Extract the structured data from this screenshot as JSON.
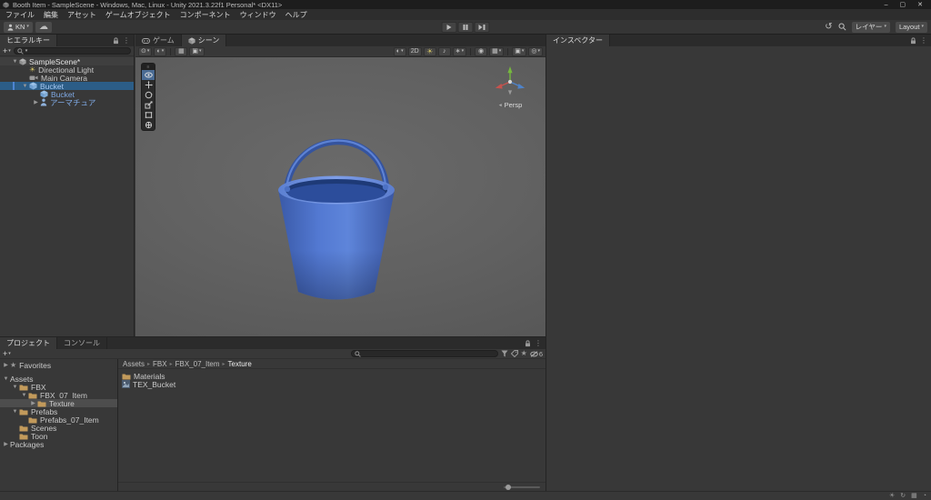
{
  "window": {
    "title": "Booth Item - SampleScene - Windows, Mac, Linux - Unity 2021.3.22f1 Personal* <DX11>",
    "minimize": "–",
    "maximize": "▢",
    "close": "✕"
  },
  "menu_bar": {
    "items": [
      "ファイル",
      "編集",
      "アセット",
      "ゲームオブジェクト",
      "コンポーネント",
      "ウィンドウ",
      "ヘルプ"
    ]
  },
  "toolbar": {
    "account_label": "KN",
    "layers_label": "レイヤー",
    "layout_label": "Layout",
    "icons": [
      "account-icon",
      "cloud-icon",
      "play-icon",
      "pause-icon",
      "step-icon",
      "undo-history-icon",
      "search-icon"
    ]
  },
  "hierarchy": {
    "tab_label": "ヒエラルキー",
    "scene_row": {
      "label": "SampleScene*",
      "expanded": true
    },
    "rows": [
      {
        "label": "Directional Light",
        "icon": "light-icon",
        "prefab": false,
        "selected": false
      },
      {
        "label": "Main Camera",
        "icon": "camera-icon",
        "prefab": false,
        "selected": false
      },
      {
        "label": "Bucket",
        "icon": "prefab-cube-icon",
        "prefab": true,
        "selected": true
      },
      {
        "label": "Bucket",
        "icon": "prefab-cube-icon",
        "prefab": true,
        "selected": false
      },
      {
        "label": "アーマチュア",
        "icon": "avatar-icon",
        "prefab": true,
        "selected": false
      }
    ]
  },
  "scene_view": {
    "game_tab": "ゲーム",
    "scene_tab": "シーン",
    "active_tab": "シーン",
    "toolbar": {
      "two_d_label": "2D",
      "left_icons": [
        "pivot-mode-icon",
        "handle-rotation-icon",
        "grid-snapping-icon",
        "snap-settings-icon"
      ],
      "right_icons": [
        "shading-mode-icon",
        "2d-toggle",
        "lighting-toggle-icon",
        "audio-toggle-icon",
        "effects-icon",
        "visibility-icon",
        "grid-icon",
        "camera-settings-icon",
        "gizmos-icon"
      ]
    },
    "tools": [
      "view-tool",
      "move-tool",
      "rotate-tool",
      "scale-tool",
      "rect-tool",
      "transform-tool"
    ],
    "active_tool": "view-tool",
    "gizmo_label": "Persp",
    "model": {
      "name": "bucket",
      "color": "#4a71c8"
    }
  },
  "inspector": {
    "tab_label": "インスペクター"
  },
  "project": {
    "project_tab": "プロジェクト",
    "console_tab": "コンソール",
    "favorites_label": "Favorites",
    "tree": [
      {
        "label": "Assets",
        "selected": false
      },
      {
        "label": "FBX",
        "selected": false
      },
      {
        "label": "FBX_07_Item",
        "selected": false
      },
      {
        "label": "Texture",
        "selected": true
      },
      {
        "label": "Prefabs",
        "selected": false
      },
      {
        "label": "Prefabs_07_Item",
        "selected": false
      },
      {
        "label": "Scenes",
        "selected": false
      },
      {
        "label": "Toon",
        "selected": false
      },
      {
        "label": "Packages",
        "selected": false
      }
    ],
    "breadcrumbs": [
      "Assets",
      "FBX",
      "FBX_07_Item",
      "Texture"
    ],
    "files": [
      {
        "label": "Materials",
        "icon": "folder-icon"
      },
      {
        "label": "TEX_Bucket",
        "icon": "texture-icon"
      }
    ],
    "hidden_count": "6"
  },
  "colors": {
    "selection_blue": "#2C5D87",
    "prefab_text_blue": "#7fa9e4",
    "bucket_blue": "#4a71c8",
    "panel_bg": "#383838",
    "tab_bg": "#2b2b2b",
    "folder_gold": "#c29a5b"
  }
}
